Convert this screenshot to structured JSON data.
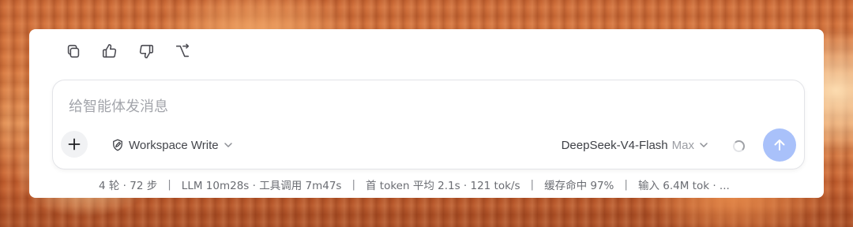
{
  "actions": [
    {
      "name": "copy",
      "icon": "copy-icon"
    },
    {
      "name": "like",
      "icon": "thumbs-up-icon"
    },
    {
      "name": "dislike",
      "icon": "thumbs-down-icon"
    },
    {
      "name": "branch",
      "icon": "branch-icon"
    }
  ],
  "composer": {
    "placeholder": "给智能体发消息",
    "value": "",
    "add_icon": "plus-icon",
    "mode_label": "Workspace Write",
    "mode_icon": "shield-edit-icon",
    "model_name": "DeepSeek-V4-Flash",
    "model_variant": "Max",
    "send_icon": "arrow-up-icon",
    "send_color": "#a9c1fa",
    "loading": true
  },
  "stats": {
    "rounds": "4 轮 · 72 步",
    "timing": "LLM 10m28s · 工具调用 7m47s",
    "first_token": "首 token 平均 2.1s · 121 tok/s",
    "cache": "缓存命中 97%",
    "input": "输入 6.4M tok · ...",
    "separator": "|"
  }
}
